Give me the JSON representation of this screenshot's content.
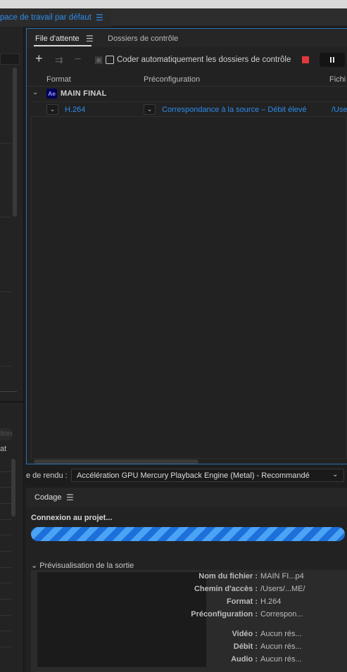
{
  "workspace": {
    "title": "pace de travail par défaut",
    "menu_icon": "hamburger-menu-icon"
  },
  "queue": {
    "tabs": {
      "queue_label": "File d'attente",
      "watch_label": "Dossiers de contrôle"
    },
    "toolbar": {
      "auto_encode_label": "Coder automatiquement les dossiers de contrôle",
      "auto_encode_checked": false
    },
    "columns": {
      "format": "Format",
      "preset": "Préconfiguration",
      "file": "Fichi"
    },
    "group": {
      "badge": "Ae",
      "name": "MAIN FINAL"
    },
    "item": {
      "format": "H.264",
      "preset": "Correspondance à la source – Débit élevé",
      "file": "/Use"
    }
  },
  "renderer": {
    "label": "e de rendu :",
    "value": "Accélération GPU Mercury Playback Engine (Metal) - Recommandé"
  },
  "encoding": {
    "tab_label": "Codage",
    "status": "Connexion au projet...",
    "preview_header": "Prévisualisation de la sortie",
    "info": {
      "filename_key": "Nom du fichier :",
      "filename_val": "MAIN FI...p4",
      "path_key": "Chemin d'accès :",
      "path_val": "/Users/...ME/",
      "format_key": "Format :",
      "format_val": "H.264",
      "preset_key": "Préconfiguration :",
      "preset_val": "Correspon...",
      "video_key": "Vidéo :",
      "video_val": "Aucun rés...",
      "bitrate_key": "Débit :",
      "bitrate_val": "Aucun rés...",
      "audio_key": "Audio :",
      "audio_val": "Aucun rés..."
    }
  },
  "left_panel": {
    "field1": "ction",
    "field2": "at"
  },
  "colors": {
    "accent": "#2d8ceb",
    "stop": "#e0393d",
    "progress_a": "#1e6fd9",
    "progress_b": "#4aa3f5"
  }
}
